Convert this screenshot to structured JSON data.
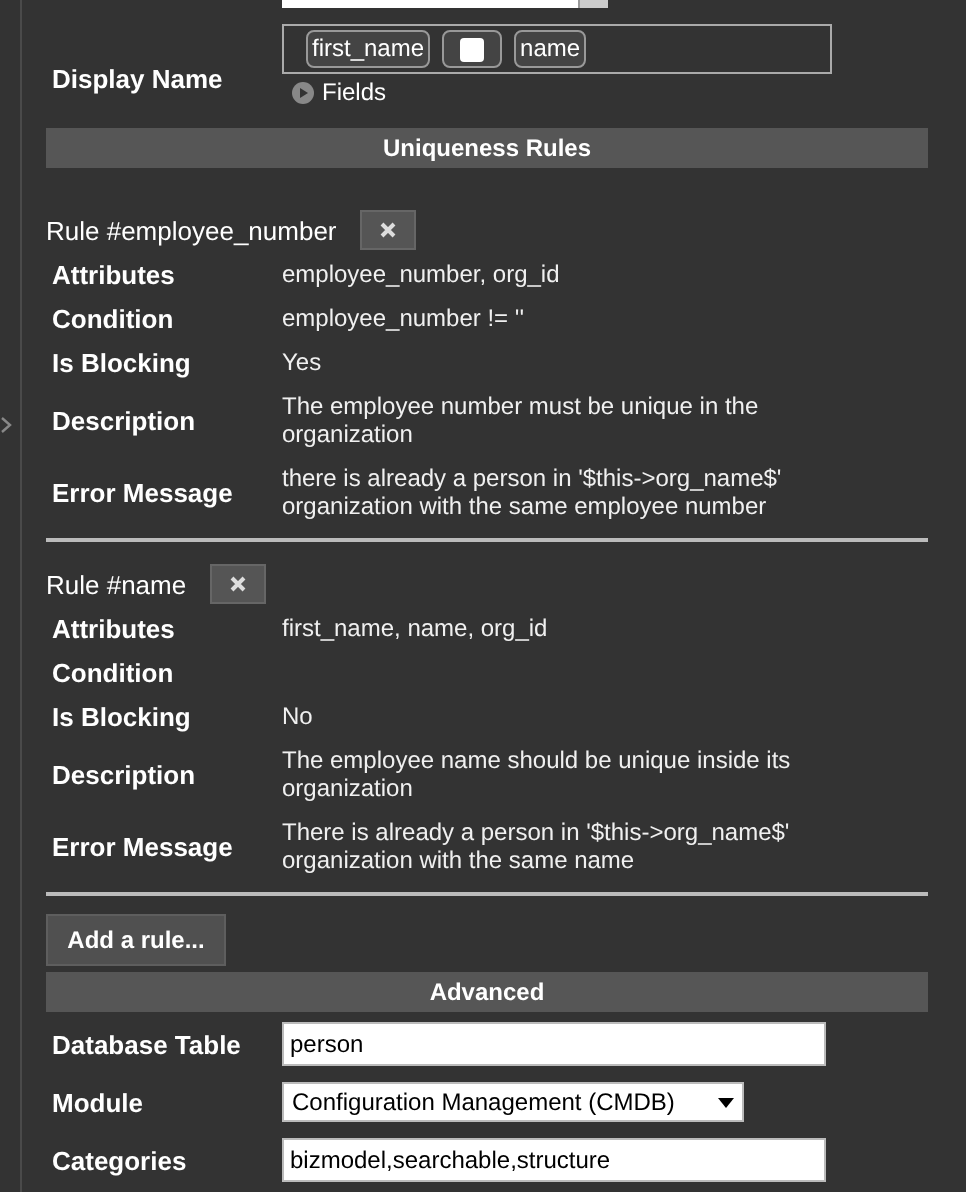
{
  "top_field": {
    "kind": "select"
  },
  "display_name": {
    "label": "Display Name",
    "tokens": [
      {
        "kind": "field",
        "text": "first_name"
      },
      {
        "kind": "space"
      },
      {
        "kind": "field",
        "text": "name"
      }
    ],
    "fields_link": "Fields"
  },
  "uniqueness": {
    "title": "Uniqueness Rules",
    "rules": [
      {
        "title": "Rule #employee_number",
        "properties": [
          {
            "label": "Attributes",
            "value": [
              "employee_number, org_id"
            ]
          },
          {
            "label": "Condition",
            "value": [
              "employee_number != ''"
            ]
          },
          {
            "label": "Is Blocking",
            "value": [
              "Yes"
            ]
          },
          {
            "label": "Description",
            "value": [
              "The employee number must be unique in the",
              "organization"
            ]
          },
          {
            "label": "Error Message",
            "value": [
              "there is already a person in '$this->org_name$'",
              "organization with the same employee number"
            ]
          }
        ]
      },
      {
        "title": "Rule #name",
        "properties": [
          {
            "label": "Attributes",
            "value": [
              "first_name, name, org_id"
            ]
          },
          {
            "label": "Condition"
          },
          {
            "label": "Is Blocking",
            "value": [
              "No"
            ]
          },
          {
            "label": "Description",
            "value": [
              "The employee name should be unique inside its",
              "organization"
            ]
          },
          {
            "label": "Error Message",
            "value": [
              "There is already a person in '$this->org_name$'",
              "organization with the same name"
            ]
          }
        ]
      }
    ],
    "add_button": "Add a rule..."
  },
  "advanced": {
    "title": "Advanced",
    "fields": [
      {
        "kind": "text",
        "label": "Database Table",
        "value": "person"
      },
      {
        "kind": "select",
        "label": "Module",
        "value": "Configuration Management (CMDB)"
      },
      {
        "kind": "text",
        "label": "Categories",
        "value": "bizmodel,searchable,structure"
      }
    ]
  }
}
